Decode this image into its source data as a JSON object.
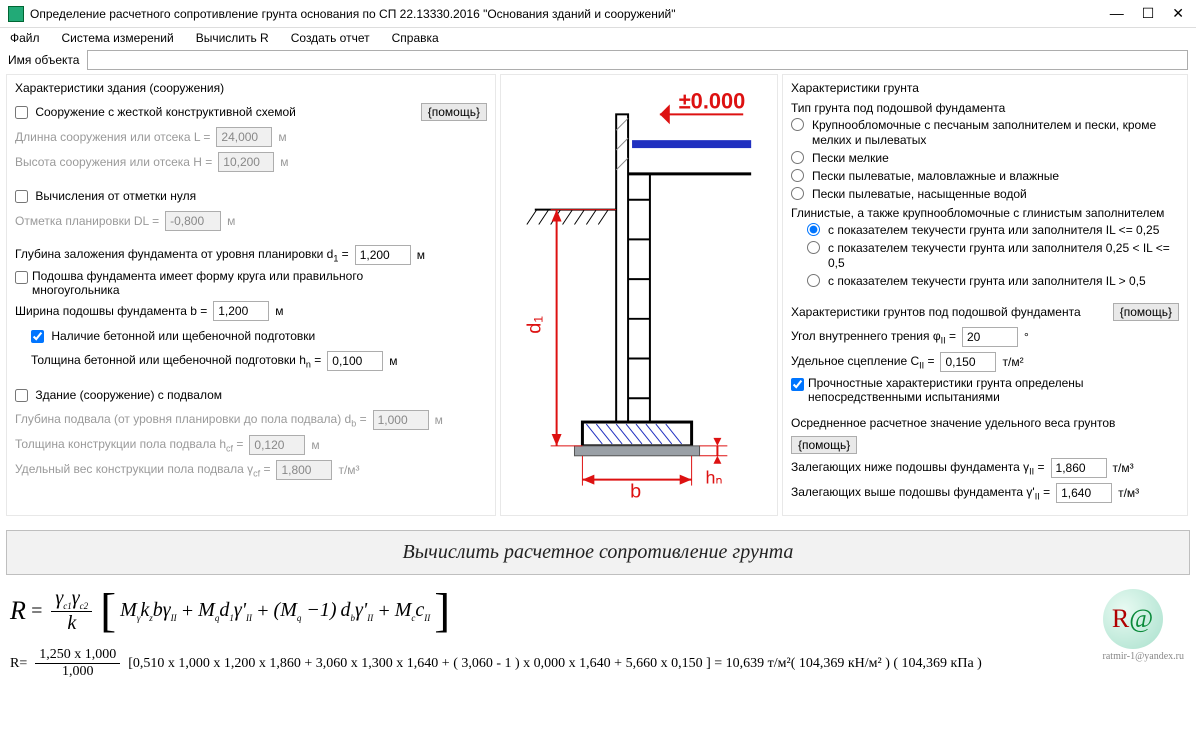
{
  "window": {
    "title": "Определение расчетного сопротивление грунта основания по СП 22.13330.2016  \"Основания зданий и сооружений\""
  },
  "menu": {
    "file": "Файл",
    "system": "Система измерений",
    "compute": "Вычислить R",
    "report": "Создать отчет",
    "help": "Справка"
  },
  "obj": {
    "label": "Имя объекта",
    "value": ""
  },
  "left": {
    "title": "Характеристики  здания (сооружения)",
    "rigid": "Сооружение с жесткой конструктивной схемой",
    "help": "{помощь}",
    "len_label": "Длинна сооружения или отсека L  =",
    "len_val": "24,000",
    "m": "м",
    "height_label": "Высота сооружения или отсека H  =",
    "height_val": "10,200",
    "zero": "Вычисления от отметки нуля",
    "dl_label": "Отметка планировки DL  =",
    "dl_val": "-0,800",
    "depth_label": "Глубина заложения фундамента от уровня планировки  d",
    "depth_sub": "1",
    "depth_eq": " =",
    "depth_val": "1,200",
    "circle": "Подошва фундамента имеет форму круга или правильного многоугольника",
    "width_label": "Ширина подошвы фундамента b  =",
    "width_val": "1,200",
    "concrete": "Наличие бетонной или щебеночной подготовки",
    "hn_label": "Толщина бетонной или щебеночной подготовки  h",
    "hn_sub": "n",
    "hn_val": "0,100",
    "basement": "Здание (сооружение) с подвалом",
    "db_label": "Глубина подвала (от уровня планировки до пола подвала) d",
    "db_sub": "b",
    "db_val": "1,000",
    "hcf_label": "Толщина конструкции пола подвала  h",
    "hcf_sub": "cf",
    "hcf_val": "0,120",
    "gcf_label": "Удельный вес конструкции пола подвала  γ",
    "gcf_sub": "cf",
    "gcf_val": "1,800",
    "tm3": "т/м³"
  },
  "diagram": {
    "zero": "±0.000",
    "d1": "d₁",
    "b": "b",
    "hn": "hₙ"
  },
  "right": {
    "title": "Характеристики грунта",
    "type_title": "Тип грунта под подошвой фундамента",
    "r1": "Крупнообломочные с песчаным заполнителем и пески, кроме мелких и пылеватых",
    "r2": "Пески мелкие",
    "r3": "Пески пылеватые, маловлажные и влажные",
    "r4": "Пески пылеватые, насыщенные водой",
    "clay_title": "Глинистые, а также крупнообломочные с глинистым заполнителем",
    "r5": "с показателем текучести грунта или заполнителя IL <= 0,25",
    "r6": "с показателем текучести грунта или заполнителя 0,25 < IL <= 0,5",
    "r7": "с показателем текучести грунта или заполнителя IL > 0,5",
    "props_title": "Характеристики грунтов под подошвой фундамента",
    "help": "{помощь}",
    "phi_label": "Угол внутреннего трения   φ",
    "phi_sub": "II",
    "phi_val": "20",
    "deg": "°",
    "c_label": "Удельное сцепление   C",
    "c_sub": "II",
    "c_val": "0,150",
    "tm2": "т/м²",
    "direct": "Прочностные характеристики грунта определены непосредственными испытаниями",
    "avg_title": "Осредненное расчетное значение удельного веса грунтов",
    "below_label": "Залегающих ниже подошвы фундамента  γ",
    "below_sub": "II",
    "below_val": "1,860",
    "tm3": "т/м³",
    "above_label": "Залегающих выше подошвы фундамента  γ'",
    "above_sub": "II",
    "above_val": "1,640"
  },
  "calc_btn": "Вычислить расчетное сопротивление грунта",
  "formula": {
    "R": "R",
    "eq": "=",
    "gc": "γ",
    "c1": "c1",
    "c2": "c2",
    "k": "k",
    "Mg": "M",
    "ga": "γ",
    "kz": "k",
    "z": "z",
    "b": "b",
    "II": "II",
    "Mq": "M",
    "q": "q",
    "d1": "d",
    "one": "1",
    "prime": "'",
    "plus": "+",
    "minus1": "−1",
    "db": "d",
    "bsub": "b",
    "Mc": "M",
    "c": "c",
    "cII": "c",
    "num": "R=",
    "frac_num": "1,250 x 1,000",
    "frac_den": "1,000",
    "body": "[0,510 x 1,000 x 1,200 x 1,860 + 3,060 x 1,300 x 1,640 + ( 3,060 - 1 ) x 0,000 x 1,640 + 5,660 x 0,150 ] = 10,639 т/м²( 104,369 кН/м² )  ( 104,369 кПа )"
  },
  "logo": {
    "email": "ratmir-1@yandex.ru"
  }
}
